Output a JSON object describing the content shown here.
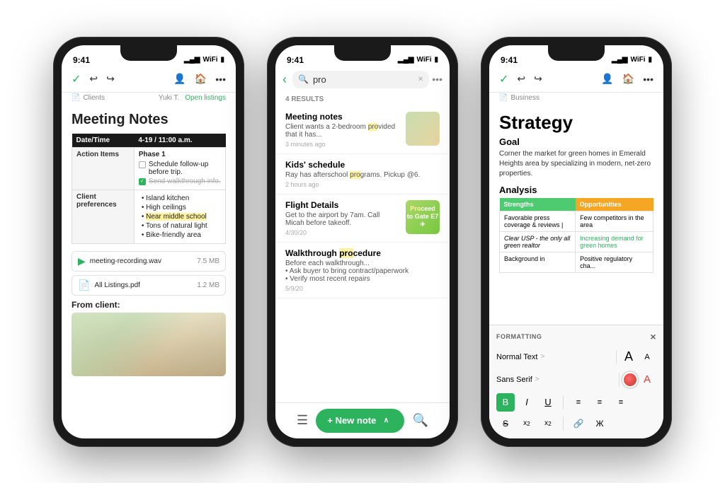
{
  "phones": [
    {
      "id": "phone1",
      "statusBar": {
        "time": "9:41",
        "signal": "●●●",
        "wifi": "WiFi",
        "battery": "🔋"
      },
      "toolbar": {
        "checkIcon": "✓",
        "undoIcon": "↩",
        "redoIcon": "↪",
        "userIcon": "👤",
        "homeIcon": "🏠",
        "moreIcon": "•••",
        "breadcrumb": "Clients",
        "userName": "Yuki T.",
        "openListings": "Open listings"
      },
      "title": "Meeting Notes",
      "table": {
        "col1": "Date/Time",
        "col2": "4-19 / 11:00 a.m.",
        "actionItems": "Action Items",
        "phase": "Phase 1",
        "tasks": [
          {
            "text": "Schedule follow-up before trip.",
            "checked": false
          },
          {
            "text": "Send walkthrough info.",
            "checked": true
          }
        ],
        "clientPrefs": "Client preferences",
        "prefs": [
          "Island kitchen",
          "High ceilings",
          "Near middle school",
          "Tons of natural light",
          "Bike-friendly area"
        ],
        "prefHighlight": "Near middle school"
      },
      "attachments": [
        {
          "type": "audio",
          "name": "meeting-recording.wav",
          "size": "7.5 MB"
        },
        {
          "type": "pdf",
          "name": "All Listings.pdf",
          "size": "1.2 MB"
        }
      ],
      "fromClient": "From client:"
    },
    {
      "id": "phone2",
      "statusBar": {
        "time": "9:41"
      },
      "searchPlaceholder": "pro",
      "resultsCount": "4 RESULTS",
      "results": [
        {
          "title": "Meeting notes",
          "snippet": "Client wants a 2-bedroom provided that it has...",
          "time": "3 minutes ago",
          "hasThumb": true,
          "thumbType": "room"
        },
        {
          "title": "Kids' schedule",
          "snippet": "Ray has afterschool programs. Pickup @6.",
          "time": "2 hours ago",
          "hasThumb": false
        },
        {
          "title": "Flight Details",
          "snippet": "Get to the airport by 7am. Call Micah before takeoff.",
          "date": "4/30/20",
          "hasThumb": true,
          "thumbType": "green"
        },
        {
          "title": "Walkthrough procedure",
          "snippet": "Before each walkthrough...\n• Ask buyer to bring contract/paperwork\n• Verify most recent repairs",
          "date": "5/9/20",
          "hasThumb": false
        }
      ],
      "newNoteLabel": "+ New note",
      "expandLabel": "^"
    },
    {
      "id": "phone3",
      "statusBar": {
        "time": "9:41"
      },
      "toolbar": {
        "checkIcon": "✓",
        "undoIcon": "↩",
        "redoIcon": "↪"
      },
      "breadcrumb": "Business",
      "title": "Strategy",
      "goalLabel": "Goal",
      "goalText": "Corner the market for green homes in Emerald Heights area by specializing in modern, net-zero properties.",
      "analysisLabel": "Analysis",
      "swot": {
        "strengthsHeader": "Strengths",
        "opportunitiesHeader": "Opportunities",
        "rows": [
          {
            "strength": "Favorable press coverage & reviews |",
            "opportunity": "Few competitors in the area"
          },
          {
            "strength": "Clear USP - the only all green realtor",
            "opportunity": "Increasing demand for green homes"
          },
          {
            "strength": "Background in",
            "opportunity": "Positive regulatory cha..."
          }
        ]
      },
      "formatting": {
        "header": "FORMATTING",
        "closeIcon": "×",
        "normalText": "Normal Text",
        "normalChevron": ">",
        "sansSerif": "Sans Serif",
        "sansChevron": ">",
        "largeFontIcon": "A",
        "smallFontIcon": "A",
        "boldLabel": "B",
        "italicLabel": "I",
        "underlineLabel": "U",
        "alignLeft": "≡",
        "alignCenter": "≡",
        "alignRight": "≡",
        "strikethroughLabel": "S",
        "superscriptLabel": "x²",
        "subscriptLabel": "x₂",
        "linkLabel": "🔗",
        "codeLabel": "Ж"
      }
    }
  ]
}
